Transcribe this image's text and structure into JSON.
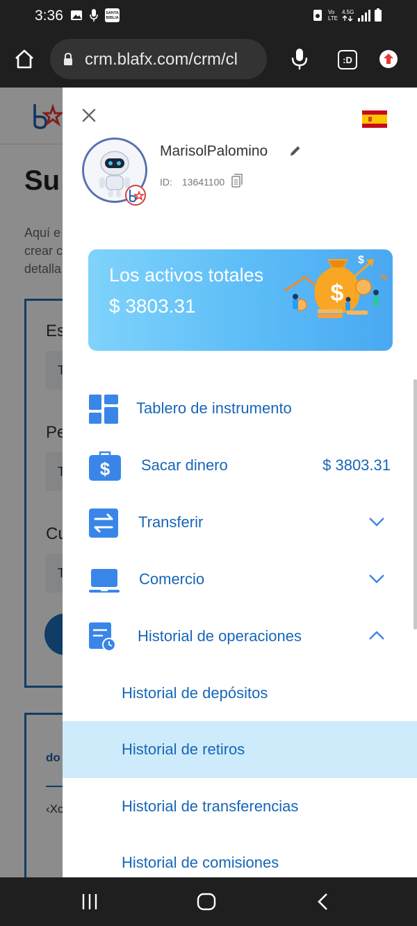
{
  "status_bar": {
    "time": "3:36",
    "icons": [
      "gallery-icon",
      "mic-icon",
      "santa-biblia-icon",
      "recycle-icon",
      "volte-icon",
      "4g-icon",
      "signal-icon",
      "battery-icon"
    ],
    "biblia_badge": "SANTA BIBLIA",
    "network_labels": [
      "Vo LTE",
      "4.5G"
    ]
  },
  "browser": {
    "url": "crm.blafx.com/crm/cl"
  },
  "background_page": {
    "title": "Su",
    "paragraph": [
      "Aquí e",
      "crear c",
      "detalla"
    ],
    "labels": [
      "Es",
      "Pe",
      "Cu"
    ],
    "field_values": [
      "T",
      "T",
      "T"
    ],
    "second_card_title": "do",
    "second_card_text": "‹Xc"
  },
  "drawer": {
    "username": "MarisolPalomino",
    "id_label": "ID:",
    "id_value": "13641100",
    "assets_label": "Los activos totales",
    "assets_value": "$ 3803.31",
    "menu": [
      {
        "label": "Tablero de instrumento",
        "value": ""
      },
      {
        "label": "Sacar dinero",
        "value": "$ 3803.31"
      },
      {
        "label": "Transferir",
        "value": ""
      },
      {
        "label": "Comercio",
        "value": ""
      },
      {
        "label": "Historial de operaciones",
        "value": ""
      }
    ],
    "submenu": [
      {
        "label": "Historial de depósitos"
      },
      {
        "label": "Historial de retiros"
      },
      {
        "label": "Historial de transferencias"
      },
      {
        "label": "Historial de comisiones"
      }
    ]
  },
  "colors": {
    "accent": "#1766b7",
    "active_bg": "#cdebfb",
    "card_gradient_start": "#7fd3fb",
    "card_gradient_end": "#4aa8f2",
    "icon_blue": "#3a86e8"
  }
}
